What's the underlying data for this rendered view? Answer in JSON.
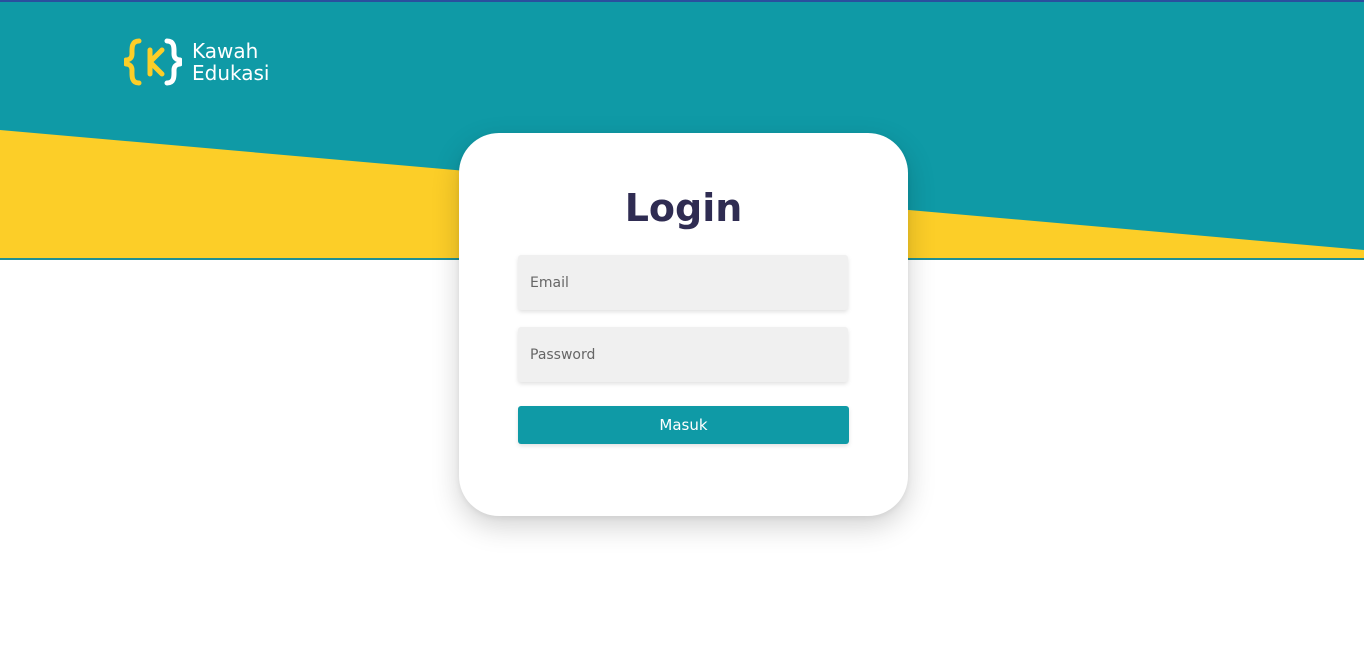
{
  "brand": {
    "name_line1": "Kawah",
    "name_line2": "Edukasi",
    "colors": {
      "teal": "#0f9aa6",
      "yellow": "#fcce28",
      "navy": "#2f2c52",
      "input_bg": "#f0f0f0"
    }
  },
  "login": {
    "title": "Login",
    "email_placeholder": "Email",
    "password_placeholder": "Password",
    "submit_label": "Masuk"
  }
}
